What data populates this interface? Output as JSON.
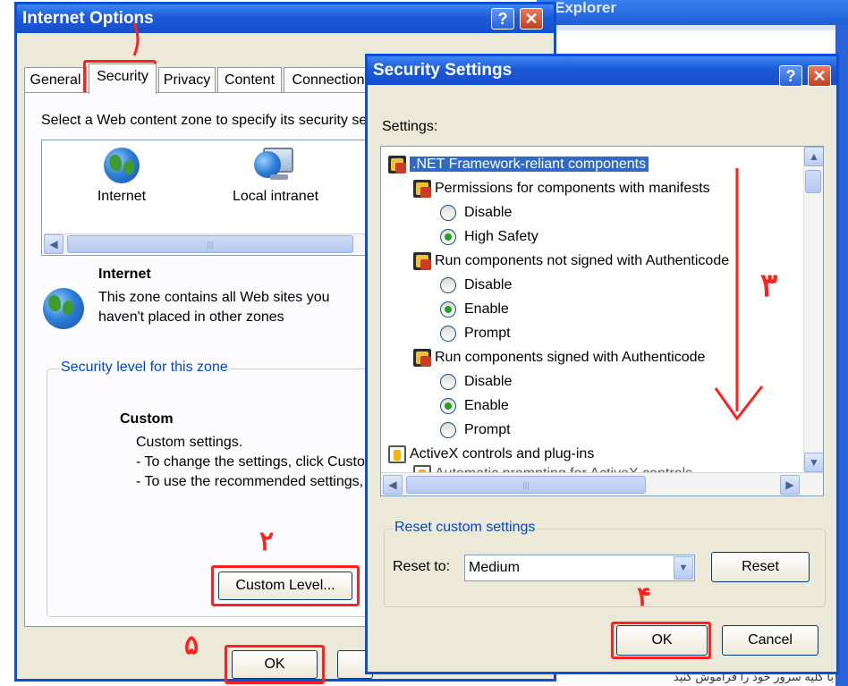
{
  "background_window": {
    "title": "Explorer",
    "status_text": "با کلیه سرور خود را فراموش کنید"
  },
  "internet_options": {
    "title": "Internet Options",
    "help_label": "?",
    "close_label": "✕",
    "tabs": [
      {
        "label": "General"
      },
      {
        "label": "Security"
      },
      {
        "label": "Privacy"
      },
      {
        "label": "Content"
      },
      {
        "label": "Connection"
      }
    ],
    "zone_prompt": "Select a Web content zone to specify its security se",
    "zones": [
      {
        "label": "Internet",
        "icon": "globe-icon"
      },
      {
        "label": "Local intranet",
        "icon": "intranet-icon"
      }
    ],
    "zone_title": "Internet",
    "zone_description_line1": "This zone contains all Web sites you",
    "zone_description_line2": "haven't placed in other zones",
    "security_level_group": "Security level for this zone",
    "level_name": "Custom",
    "level_desc_1": "Custom settings.",
    "level_desc_2": "- To change the settings, click Custon",
    "level_desc_3": "- To use the recommended settings, c",
    "custom_level_button": "Custom Level...",
    "ok_button": "OK"
  },
  "security_settings": {
    "title": "Security Settings",
    "help_label": "?",
    "close_label": "✕",
    "settings_label": "Settings:",
    "tree": {
      "root": ".NET Framework-reliant components",
      "group1": "Permissions for components with manifests",
      "group1_opt1": "Disable",
      "group1_opt2": "High Safety",
      "group2": "Run components not signed with Authenticode",
      "group2_opt1": "Disable",
      "group2_opt2": "Enable",
      "group2_opt3": "Prompt",
      "group3": "Run components signed with Authenticode",
      "group3_opt1": "Disable",
      "group3_opt2": "Enable",
      "group3_opt3": "Prompt",
      "activex": "ActiveX controls and plug-ins",
      "activex_child": "Automatic prompting for ActiveX controls"
    },
    "reset_group": "Reset custom settings",
    "reset_to_label": "Reset to:",
    "reset_to_value": "Medium",
    "reset_button": "Reset",
    "ok_button": "OK",
    "cancel_button": "Cancel"
  },
  "annotations": {
    "step2": "۲",
    "step3": "۳",
    "step4": "۴",
    "step5": "۵"
  },
  "colors": {
    "titlebar": "#1b5ad8",
    "dialog_face": "#ece9d8",
    "selection": "#316ac5",
    "annotation_red": "#ff2020",
    "link_blue": "#0046d5"
  }
}
